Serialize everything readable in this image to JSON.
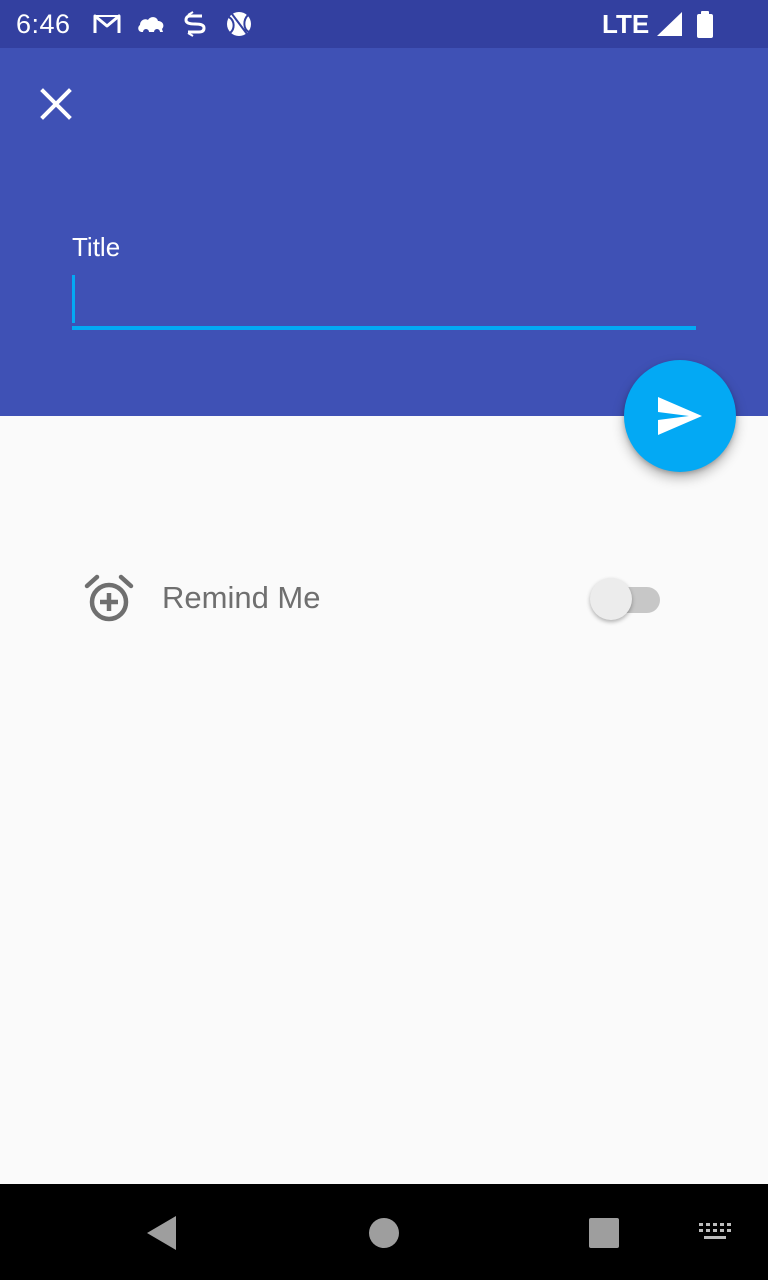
{
  "status_bar": {
    "time": "6:46",
    "network": "LTE",
    "icons": [
      "gmail-icon",
      "cloud-icon",
      "sync-icon",
      "basketball-icon",
      "signal-icon",
      "battery-icon"
    ]
  },
  "header": {
    "close_icon": "close-icon",
    "title_label": "Title",
    "title_value": ""
  },
  "fab": {
    "icon": "send-icon"
  },
  "reminder": {
    "icon": "alarm-add-icon",
    "label": "Remind Me",
    "enabled": false
  },
  "navigation": {
    "buttons": [
      "back-icon",
      "home-icon",
      "recents-icon",
      "keyboard-icon"
    ]
  },
  "colors": {
    "status_bar": "#3340a0",
    "primary": "#3f51b5",
    "accent": "#03a9f4",
    "background": "#fafafa"
  }
}
